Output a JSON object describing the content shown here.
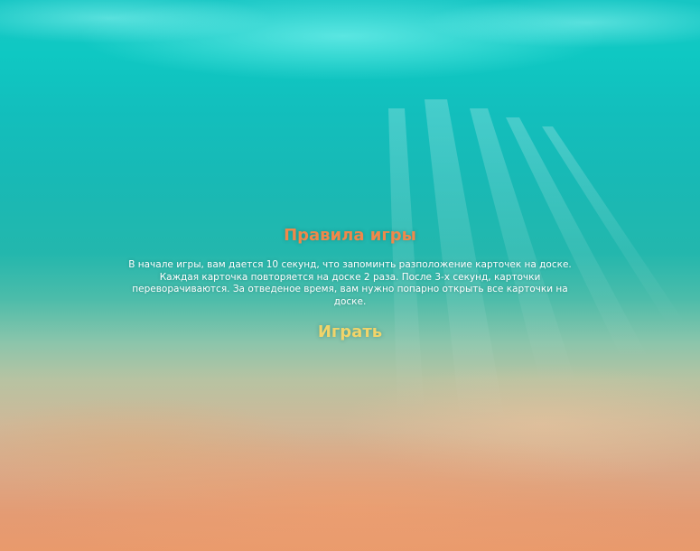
{
  "rules": {
    "title": "Правила игры",
    "text": "В начале игры, вам дается 10 секунд, что запоминть разположение карточек на доске. Каждая карточка повторяется на доске 2 раза. После 3-х секунд, карточки переворачиваются. За отведеное время, вам нужно попарно открыть все карточки на доске."
  },
  "play": {
    "label": "Играть"
  },
  "colors": {
    "title": "#f0884a",
    "text": "#ffffff",
    "play": "#f1d46a",
    "water": "#12bfbd",
    "sand": "#e49b73"
  },
  "background": {
    "scene": "underwater-seabed-with-sun-rays"
  }
}
